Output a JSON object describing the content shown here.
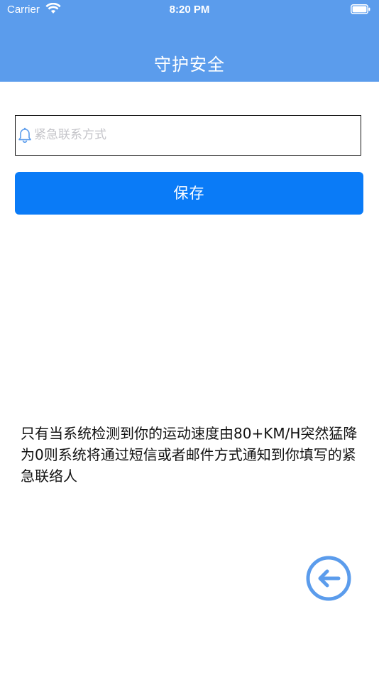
{
  "status_bar": {
    "carrier": "Carrier",
    "time": "8:20 PM",
    "wifi_icon": "wifi-icon",
    "battery_icon": "battery-icon"
  },
  "nav": {
    "title": "守护安全",
    "background_color": "#5b9cec"
  },
  "contact": {
    "placeholder": "紧急联系方式",
    "value": "",
    "icon": "bell-icon"
  },
  "save_button": {
    "label": "保存",
    "color": "#0a7bf7"
  },
  "notice": {
    "text": "只有当系统检测到你的运动速度由80+KM/H突然猛降为0则系统将通过短信或者邮件方式通知到你填写的紧急联络人"
  },
  "back_button": {
    "icon": "back-arrow-icon",
    "color": "#5b9cec"
  }
}
